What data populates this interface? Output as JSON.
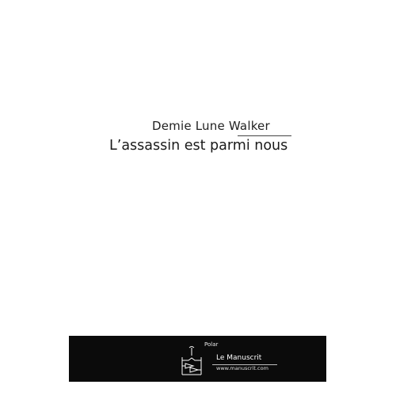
{
  "cover": {
    "author": "Demie Lune Walker",
    "title": "L’assassin est parmi nous",
    "background_color": "#ffffff"
  },
  "footer": {
    "genre": "Polar",
    "publisher": "Le Manuscrit",
    "website": "www.manuscrit.com",
    "logo_icon": "publisher-logo-icon",
    "band_color": "#0b0b0b"
  }
}
